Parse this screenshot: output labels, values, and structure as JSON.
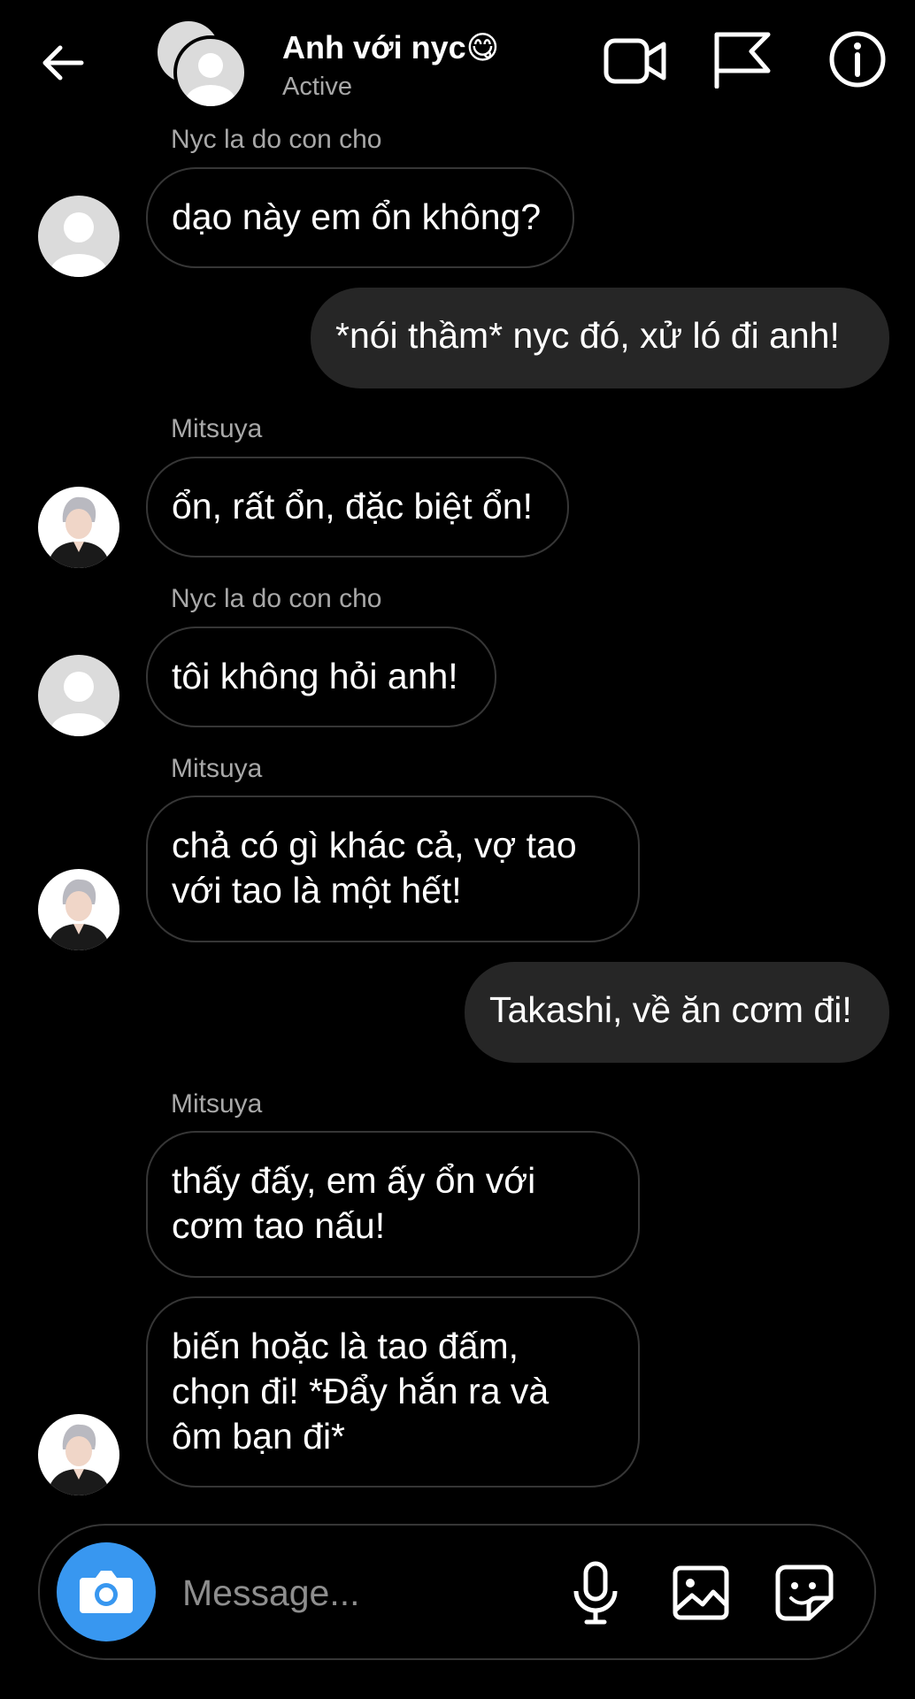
{
  "header": {
    "back_icon": "arrow-left-icon",
    "group_name": "Anh với nyc😋",
    "status": "Active",
    "actions": [
      "video-call-icon",
      "flag-icon",
      "info-icon"
    ]
  },
  "messages": [
    {
      "sender": "Nyc la do con cho",
      "text": "dạo này em ổn không?",
      "direction": "in",
      "avatar": "default"
    },
    {
      "text": "*nói thầm* nyc đó, xử ló đi anh!",
      "direction": "out"
    },
    {
      "sender": "Mitsuya",
      "text": "ổn, rất ổn, đặc biệt ổn!",
      "direction": "in",
      "avatar": "mitsuya"
    },
    {
      "sender": "Nyc la do con cho",
      "text": "tôi không hỏi anh!",
      "direction": "in",
      "avatar": "default"
    },
    {
      "sender": "Mitsuya",
      "text": "chả có gì khác cả, vợ tao\nvới tao là một hết!",
      "direction": "in",
      "avatar": "mitsuya"
    },
    {
      "text": "Takashi, về ăn cơm đi!",
      "direction": "out"
    },
    {
      "sender": "Mitsuya",
      "text": "thấy đấy, em ấy ổn với\ncơm tao nấu!",
      "direction": "in"
    },
    {
      "text": "biến hoặc là tao đấm,\nchọn đi! *Đẩy hắn ra và\nôm bạn đi*",
      "direction": "in",
      "avatar": "mitsuya"
    }
  ],
  "composer": {
    "placeholder": "Message...",
    "icons": [
      "camera-icon",
      "microphone-icon",
      "gallery-icon",
      "sticker-icon"
    ]
  },
  "colors": {
    "background": "#000000",
    "outgoing_bubble": "#262626",
    "incoming_border": "#363636",
    "secondary_text": "#a8a8a8",
    "camera_button": "#3897f0"
  }
}
